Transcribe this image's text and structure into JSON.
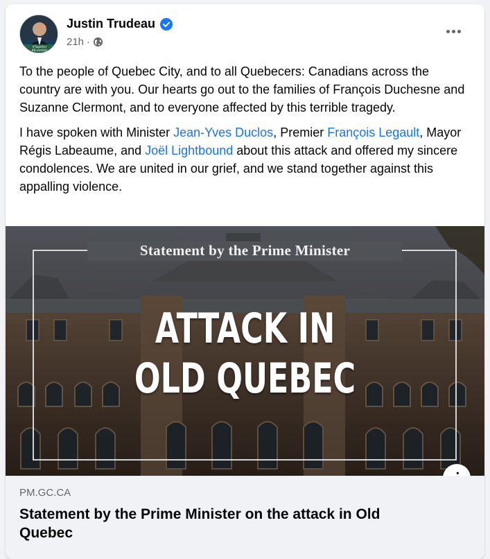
{
  "post": {
    "author": "Justin Trudeau",
    "time": "21h",
    "separator": "·",
    "paragraph1": "To the people of Quebec City, and to all Quebecers: Canadians across the country are with you. Our hearts go out to the families of François Duchesne and Suzanne Clermont, and to everyone affected by this terrible tragedy.",
    "p2_a": "I have spoken with Minister ",
    "mention1": "Jean-Yves Duclos",
    "p2_b": ", Premier ",
    "mention2": "François Legault",
    "p2_c": ", Mayor Régis Labeaume, and ",
    "mention3": "Joël Lightbound",
    "p2_d": " about this attack and offered my sincere condolences. We are united in our grief, and we stand together against this appalling violence."
  },
  "image": {
    "banner_title": "Statement by the Prime Minister",
    "headline_line1": "ATTACK IN",
    "headline_line2": "OLD QUEBEC"
  },
  "link": {
    "domain": "PM.GC.CA",
    "title": "Statement by the Prime Minister on the attack in Old Quebec"
  },
  "icons": {
    "verified": "verified-badge-icon",
    "audience": "globe-icon",
    "more": "more-options-icon",
    "info": "info-icon"
  },
  "colors": {
    "link": "#1b74e4",
    "verified": "#1877f2",
    "secondary_text": "#65676b",
    "preview_bg": "#f0f2f5"
  }
}
